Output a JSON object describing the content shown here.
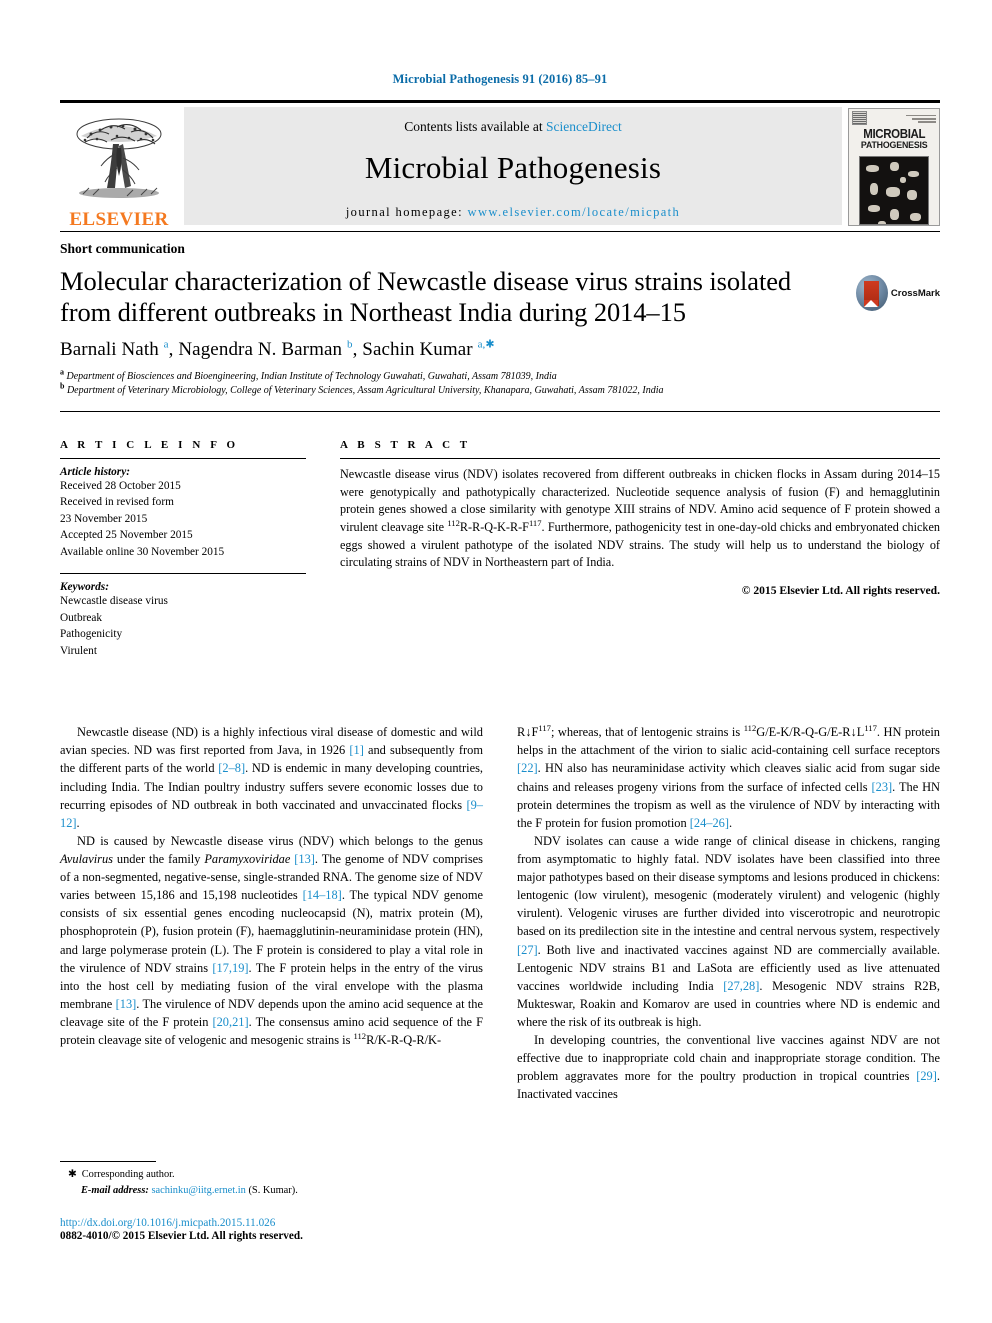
{
  "running_head": "Microbial Pathogenesis 91 (2016) 85–91",
  "masthead": {
    "publisher": "ELSEVIER",
    "contents_prefix": "Contents lists available at",
    "contents_link": "ScienceDirect",
    "journal_title": "Microbial Pathogenesis",
    "homepage_prefix": "journal homepage:",
    "homepage_url": "www.elsevier.com/locate/micpath",
    "cover_title_line1": "MICROBIAL",
    "cover_title_line2": "PATHOGENESIS"
  },
  "article": {
    "section_type": "Short communication",
    "title": "Molecular characterization of Newcastle disease virus strains isolated from different outbreaks in Northeast India during 2014–15",
    "crossmark_label": "CrossMark",
    "authors_html": "Barnali Nath <sup>a</sup>, Nagendra N. Barman <sup>b</sup>, Sachin Kumar <sup>a,✱</sup>",
    "affiliations": [
      "Department of Biosciences and Bioengineering, Indian Institute of Technology Guwahati, Guwahati, Assam 781039, India",
      "Department of Veterinary Microbiology, College of Veterinary Sciences, Assam Agricultural University, Khanapara, Guwahati, Assam 781022, India"
    ],
    "affiliation_marks": [
      "a",
      "b"
    ]
  },
  "article_info": {
    "heading": "A R T I C L E   I N F O",
    "history_label": "Article history:",
    "history": [
      "Received 28 October 2015",
      "Received in revised form",
      "23 November 2015",
      "Accepted 25 November 2015",
      "Available online 30 November 2015"
    ],
    "keywords_label": "Keywords:",
    "keywords": [
      "Newcastle disease virus",
      "Outbreak",
      "Pathogenicity",
      "Virulent"
    ]
  },
  "abstract": {
    "heading": "A B S T R A C T",
    "text_html": "Newcastle disease virus (NDV) isolates recovered from different outbreaks in chicken flocks in Assam during 2014–15 were genotypically and pathotypically characterized. Nucleotide sequence analysis of fusion (F) and hemagglutinin protein genes showed a close similarity with genotype XIII strains of NDV. Amino acid sequence of F protein showed a virulent cleavage site <sup>112</sup>R-R-Q-K-R-F<sup>117</sup>. Furthermore, pathogenicity test in one-day-old chicks and embryonated chicken eggs showed a virulent pathotype of the isolated NDV strains. The study will help us to understand the biology of circulating strains of NDV in Northeastern part of India.",
    "copyright": "© 2015 Elsevier Ltd. All rights reserved."
  },
  "body": {
    "left_column": [
      "Newcastle disease (ND) is a highly infectious viral disease of domestic and wild avian species. ND was first reported from Java, in 1926 <span class=\"ref\">[1]</span> and subsequently from the different parts of the world <span class=\"ref\">[2–8]</span>. ND is endemic in many developing countries, including India. The Indian poultry industry suffers severe economic losses due to recurring episodes of ND outbreak in both vaccinated and unvaccinated flocks <span class=\"ref\">[9–12]</span>.",
      "ND is caused by Newcastle disease virus (NDV) which belongs to the genus <span class=\"it\">Avulavirus</span> under the family <span class=\"it\">Paramyxoviridae</span> <span class=\"ref\">[13]</span>. The genome of NDV comprises of a non-segmented, negative-sense, single-stranded RNA. The genome size of NDV varies between 15,186 and 15,198 nucleotides <span class=\"ref\">[14–18]</span>. The typical NDV genome consists of six essential genes encoding nucleocapsid (N), matrix protein (M), phosphoprotein (P), fusion protein (F), haemagglutinin-neuraminidase protein (HN), and large polymerase protein (L). The F protein is considered to play a vital role in the virulence of NDV strains <span class=\"ref\">[17,19]</span>. The F protein helps in the entry of the virus into the host cell by mediating fusion of the viral envelope with the plasma membrane <span class=\"ref\">[13]</span>. The virulence of NDV depends upon the amino acid sequence at the cleavage site of the F protein <span class=\"ref\">[20,21]</span>. The consensus amino acid sequence of the F protein cleavage site of velogenic and mesogenic strains is <sup>112</sup>R/K-R-Q-R/K-"
    ],
    "right_column": [
      "R↓F<sup>117</sup>; whereas, that of lentogenic strains is <sup>112</sup>G/E-K/R-Q-G/E-R↓L<sup>117</sup>. HN protein helps in the attachment of the virion to sialic acid-containing cell surface receptors <span class=\"ref\">[22]</span>. HN also has neuraminidase activity which cleaves sialic acid from sugar side chains and releases progeny virions from the surface of infected cells <span class=\"ref\">[23]</span>. The HN protein determines the tropism as well as the virulence of NDV by interacting with the F protein for fusion promotion <span class=\"ref\">[24–26]</span>.",
      "NDV isolates can cause a wide range of clinical disease in chickens, ranging from asymptomatic to highly fatal. NDV isolates have been classified into three major pathotypes based on their disease symptoms and lesions produced in chickens: lentogenic (low virulent), mesogenic (moderately virulent) and velogenic (highly virulent). Velogenic viruses are further divided into viscerotropic and neurotropic based on its predilection site in the intestine and central nervous system, respectively <span class=\"ref\">[27]</span>. Both live and inactivated vaccines against ND are commercially available. Lentogenic NDV strains B1 and LaSota are efficiently used as live attenuated vaccines worldwide including India <span class=\"ref\">[27,28]</span>. Mesogenic NDV strains R2B, Mukteswar, Roakin and Komarov are used in countries where ND is endemic and where the risk of its outbreak is high.",
      "In developing countries, the conventional live vaccines against NDV are not effective due to inappropriate cold chain and inappropriate storage condition. The problem aggravates more for the poultry production in tropical countries <span class=\"ref\">[29]</span>. Inactivated vaccines"
    ]
  },
  "footer": {
    "corresponding_mark": "✱",
    "corresponding_label": "Corresponding author.",
    "email_label": "E-mail address:",
    "email": "sachinku@iitg.ernet.in",
    "email_suffix": "(S. Kumar).",
    "doi": "http://dx.doi.org/10.1016/j.micpath.2015.11.026",
    "issn_line": "0882-4010/© 2015 Elsevier Ltd. All rights reserved."
  },
  "colors": {
    "link": "#1a8ecb",
    "running_head": "#0b6ca8",
    "elsevier_orange": "#F47920",
    "masthead_bg": "#e9e9e9"
  }
}
